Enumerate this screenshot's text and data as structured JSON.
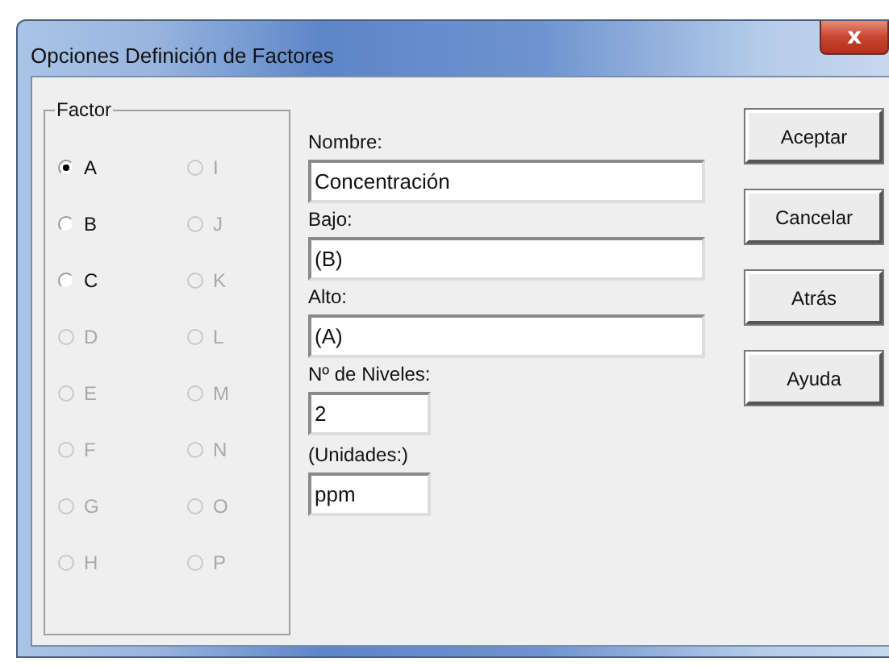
{
  "window": {
    "title": "Opciones Definición de Factores",
    "close": "x"
  },
  "factor_group": {
    "label": "Factor",
    "options": [
      {
        "label": "A",
        "selected": true,
        "disabled": false
      },
      {
        "label": "B",
        "selected": false,
        "disabled": false
      },
      {
        "label": "C",
        "selected": false,
        "disabled": false
      },
      {
        "label": "D",
        "selected": false,
        "disabled": true
      },
      {
        "label": "E",
        "selected": false,
        "disabled": true
      },
      {
        "label": "F",
        "selected": false,
        "disabled": true
      },
      {
        "label": "G",
        "selected": false,
        "disabled": true
      },
      {
        "label": "H",
        "selected": false,
        "disabled": true
      },
      {
        "label": "I",
        "selected": false,
        "disabled": true
      },
      {
        "label": "J",
        "selected": false,
        "disabled": true
      },
      {
        "label": "K",
        "selected": false,
        "disabled": true
      },
      {
        "label": "L",
        "selected": false,
        "disabled": true
      },
      {
        "label": "M",
        "selected": false,
        "disabled": true
      },
      {
        "label": "N",
        "selected": false,
        "disabled": true
      },
      {
        "label": "O",
        "selected": false,
        "disabled": true
      },
      {
        "label": "P",
        "selected": false,
        "disabled": true
      }
    ]
  },
  "fields": [
    {
      "label": "Nombre:",
      "value": "Concentración",
      "kind": "wide"
    },
    {
      "label": "Bajo:",
      "value": "(B)",
      "kind": "wide"
    },
    {
      "label": "Alto:",
      "value": "(A)",
      "kind": "wide"
    },
    {
      "label": "Nº de Niveles:",
      "value": "2",
      "kind": "short"
    },
    {
      "label": "(Unidades:)",
      "value": "ppm",
      "kind": "short"
    }
  ],
  "buttons": [
    "Aceptar",
    "Cancelar",
    "Atrás",
    "Ayuda"
  ]
}
